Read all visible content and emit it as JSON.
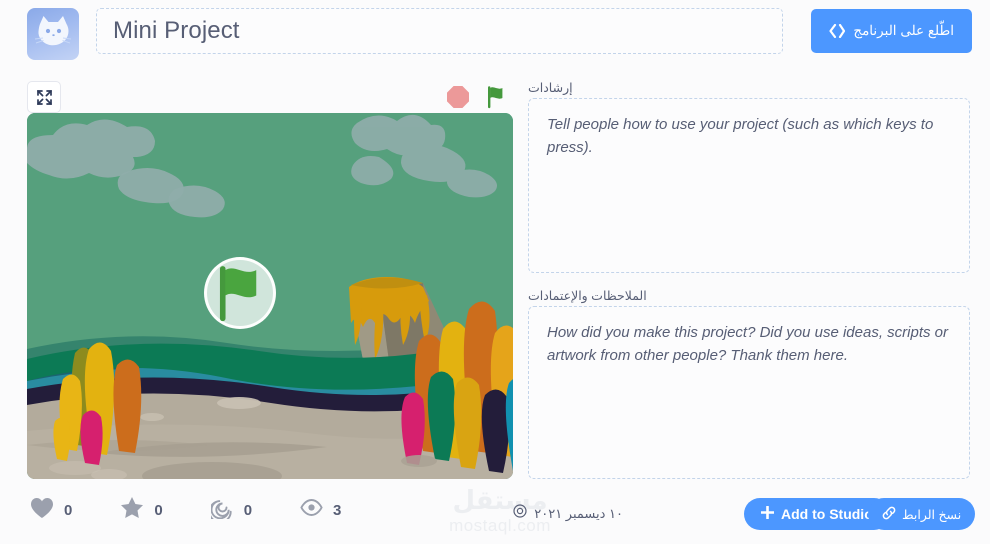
{
  "header": {
    "avatar_icon": "cat-avatar-icon",
    "project_title": "Mini Project",
    "see_inside_label": "اطّلع على البرنامج",
    "see_inside_icon": "code-brackets-icon"
  },
  "player": {
    "fullscreen_icon": "fullscreen-expand-icon",
    "stop_icon": "stop-octagon-icon",
    "green_flag_icon": "green-flag-icon",
    "start_overlay_icon": "green-flag-icon"
  },
  "stats": [
    {
      "icon": "heart-icon",
      "name": "loves",
      "count": "0"
    },
    {
      "icon": "star-icon",
      "name": "favorites",
      "count": "0"
    },
    {
      "icon": "remix-spiral-icon",
      "name": "remixes",
      "count": "0"
    },
    {
      "icon": "eye-icon",
      "name": "views",
      "count": "3"
    }
  ],
  "watermark": {
    "arabic": "مستقل",
    "latin": "mostaql.com"
  },
  "sections": {
    "instructions": {
      "label": "إرشادات",
      "placeholder": "Tell people how to use your project (such as which keys to press).",
      "value": ""
    },
    "credits": {
      "label": "الملاحظات والإعتمادات",
      "placeholder": "How did you make this project? Did you use ideas, scripts or artwork from other people? Thank them here.",
      "value": ""
    }
  },
  "footer": {
    "date_icon": "clock-spiral-icon",
    "date_text": "١٠ ديسمبر ٢٠٢١",
    "add_to_studio_label": "Add to Studio",
    "add_to_studio_icon": "plus-icon",
    "copy_link_label": "نسخ الرابط",
    "copy_link_icon": "link-chain-icon"
  },
  "colors": {
    "accent_blue": "#4c97ff",
    "text": "#575e75",
    "dashed_border": "#c3d4ea",
    "page_bg": "#fbfbfc",
    "stop_red": "#ec9999",
    "flag_green": "#45993d",
    "stage_sky": "#56a07d"
  },
  "stage_scene": {
    "name": "jurassic-volcano-backdrop",
    "sky": "#56a07d",
    "cloud": "#8fadaa",
    "volcano_rock": "#8f8975",
    "volcano_lava": "#d79b0c",
    "sand": "#b3ab9c",
    "water_dark": "#1b6470",
    "water_deep": "#231d3a",
    "grass_green": "#0c7a55"
  }
}
